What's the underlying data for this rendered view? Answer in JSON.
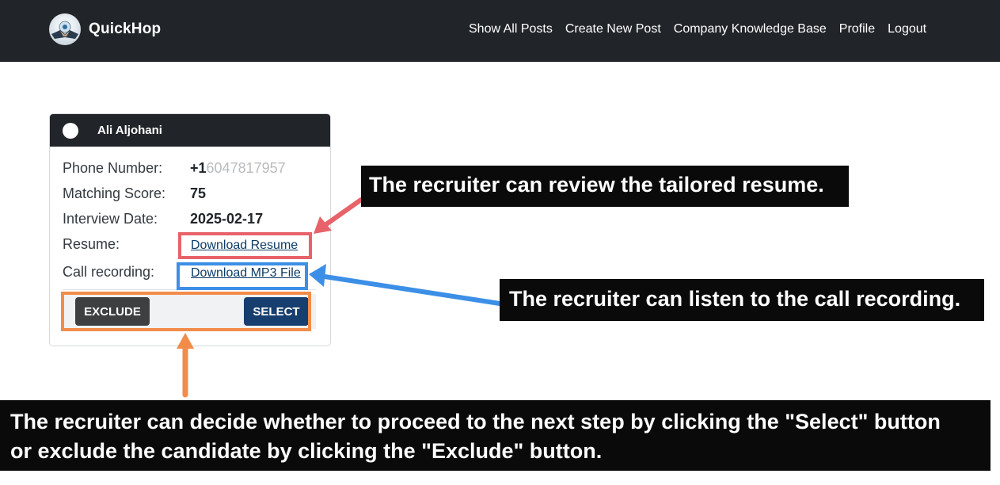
{
  "nav": {
    "brand": "QuickHop",
    "links": [
      "Show All Posts",
      "Create New Post",
      "Company Knowledge Base",
      "Profile",
      "Logout"
    ]
  },
  "card": {
    "name": "Ali Aljohani",
    "phone_label": "Phone Number:",
    "phone_prefix": "+1",
    "phone_rest": "6047817957",
    "score_label": "Matching Score:",
    "score_value": "75",
    "interview_label": "Interview Date:",
    "interview_value": "2025-02-17",
    "resume_label": "Resume:",
    "resume_link": "Download Resume",
    "recording_label": "Call recording:",
    "recording_link": "Download MP3 File",
    "exclude_button": "EXCLUDE",
    "select_button": "SELECT"
  },
  "callouts": {
    "resume": "The recruiter can review the tailored resume.",
    "recording": "The recruiter can listen to the call recording.",
    "decision_line1": "The recruiter can decide whether to proceed to the next step by clicking the \"Select\" button",
    "decision_line2": "or exclude the candidate by clicking the \"Exclude\" button."
  },
  "colors": {
    "navbar": "#212529",
    "highlight_resume": "#e8626a",
    "highlight_recording": "#3c8fe6",
    "highlight_buttons": "#f28c4a",
    "select_button": "#163e6e",
    "exclude_button": "#3d3f40"
  }
}
